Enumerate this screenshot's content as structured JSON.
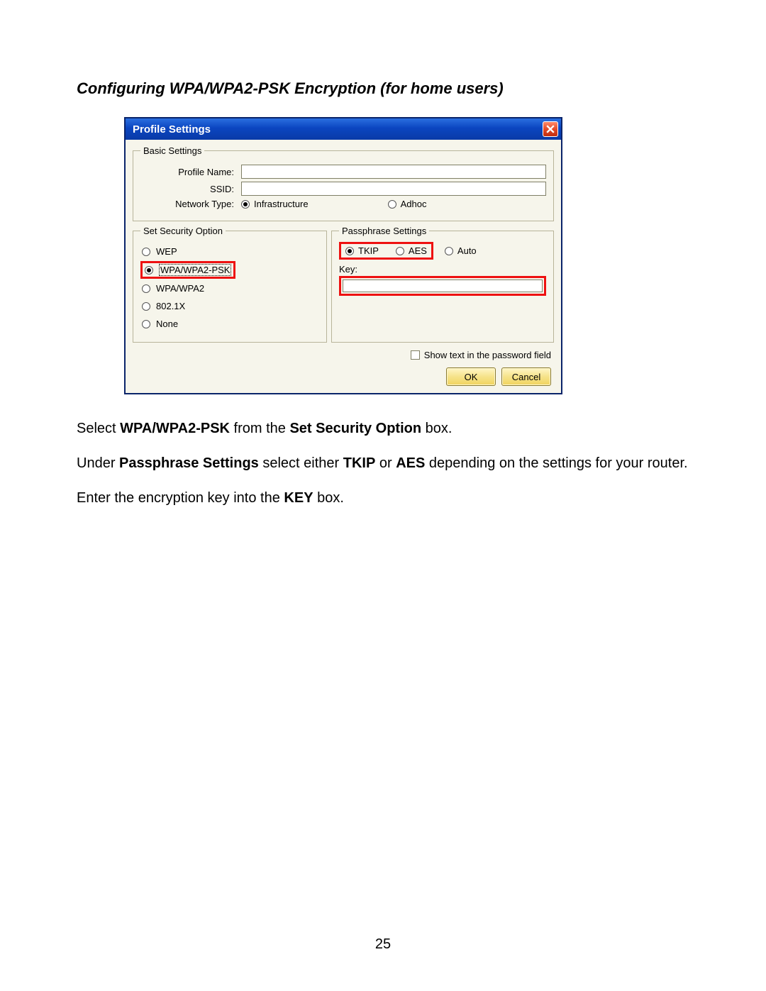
{
  "heading": "Configuring WPA/WPA2-PSK Encryption (for home users)",
  "dialog": {
    "title": "Profile Settings",
    "basic": {
      "legend": "Basic Settings",
      "profile_name_label": "Profile Name:",
      "profile_name_value": "",
      "ssid_label": "SSID:",
      "ssid_value": "",
      "network_type_label": "Network Type:",
      "infrastructure": "Infrastructure",
      "adhoc": "Adhoc",
      "network_type_selected": "Infrastructure"
    },
    "security": {
      "legend": "Set Security Option",
      "options": [
        "WEP",
        "WPA/WPA2-PSK",
        "WPA/WPA2",
        "802.1X",
        "None"
      ],
      "selected": "WPA/WPA2-PSK"
    },
    "passphrase": {
      "legend": "Passphrase Settings",
      "ciphers": [
        "TKIP",
        "AES",
        "Auto"
      ],
      "cipher_selected": "TKIP",
      "key_label": "Key:",
      "key_value": ""
    },
    "show_text_label": "Show text in the password field",
    "show_text_checked": false,
    "ok_label": "OK",
    "cancel_label": "Cancel"
  },
  "instructions": {
    "p1_a": "Select ",
    "p1_b": "WPA/WPA2-PSK",
    "p1_c": " from the ",
    "p1_d": "Set Security Option",
    "p1_e": " box.",
    "p2_a": "Under ",
    "p2_b": "Passphrase Settings",
    "p2_c": " select either ",
    "p2_d": "TKIP",
    "p2_e": " or ",
    "p2_f": "AES",
    "p2_g": " depending on the settings for your router.",
    "p3_a": "Enter the encryption key into the ",
    "p3_b": "KEY",
    "p3_c": " box."
  },
  "page_number": "25"
}
